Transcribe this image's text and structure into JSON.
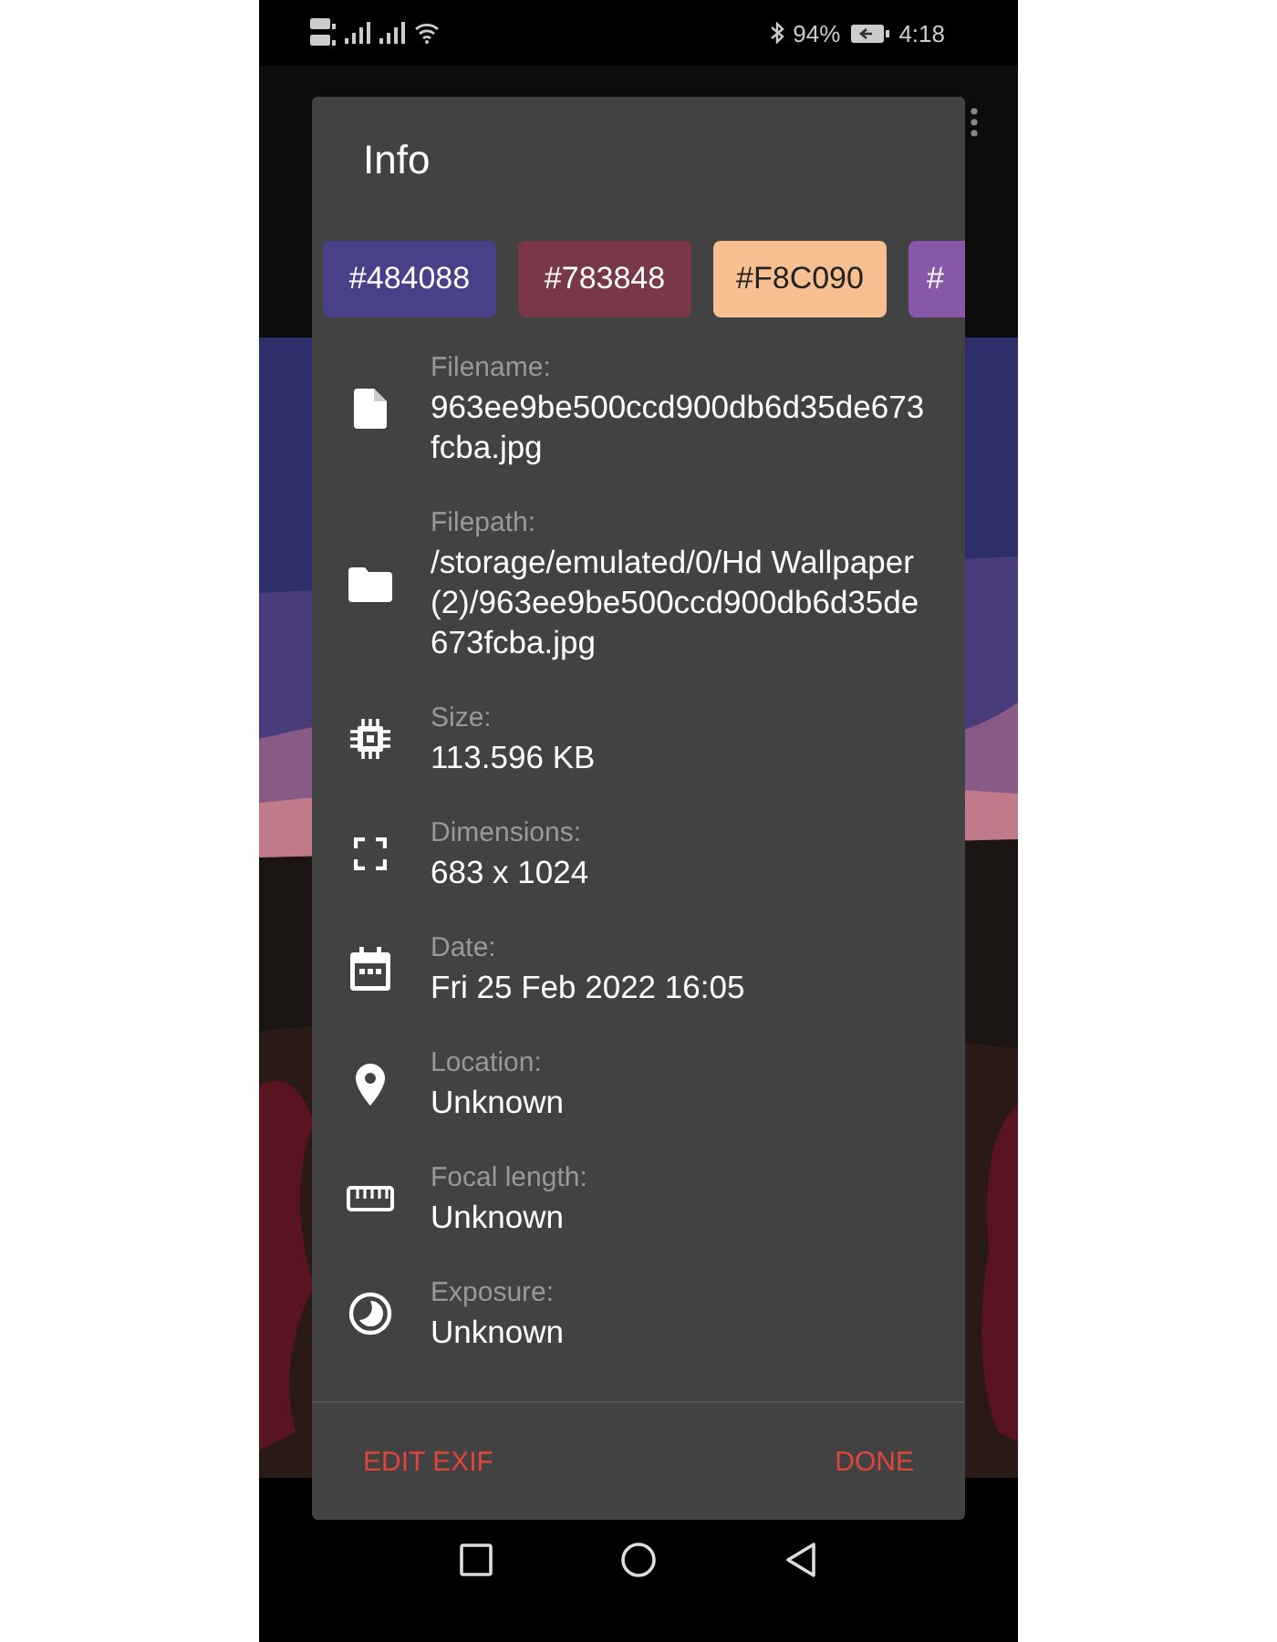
{
  "status_bar": {
    "battery": "94%",
    "time": "4:18"
  },
  "dialog": {
    "title": "Info",
    "swatches": [
      {
        "label": "#484088",
        "color": "#484088"
      },
      {
        "label": "#783848",
        "color": "#783848"
      },
      {
        "label": "#F8C090",
        "color": "#f8c090"
      },
      {
        "label": "#",
        "color": "#8858a8"
      }
    ],
    "rows": [
      {
        "kind": "file",
        "label": "Filename:",
        "value": "963ee9be500ccd900db6d35de673fcba.jpg"
      },
      {
        "kind": "folder",
        "label": "Filepath:",
        "value": "/storage/emulated/0/Hd Wallpaper (2)/963ee9be500ccd900db6d35de673fcba.jpg"
      },
      {
        "kind": "chip",
        "label": "Size:",
        "value": "113.596 KB"
      },
      {
        "kind": "frame",
        "label": "Dimensions:",
        "value": "683 x 1024"
      },
      {
        "kind": "calendar",
        "label": "Date:",
        "value": "Fri 25 Feb 2022 16:05"
      },
      {
        "kind": "pin",
        "label": "Location:",
        "value": "Unknown"
      },
      {
        "kind": "ruler",
        "label": "Focal length:",
        "value": "Unknown"
      },
      {
        "kind": "exposure",
        "label": "Exposure:",
        "value": "Unknown"
      }
    ],
    "buttons": [
      "EDIT EXIF",
      "DONE"
    ]
  }
}
